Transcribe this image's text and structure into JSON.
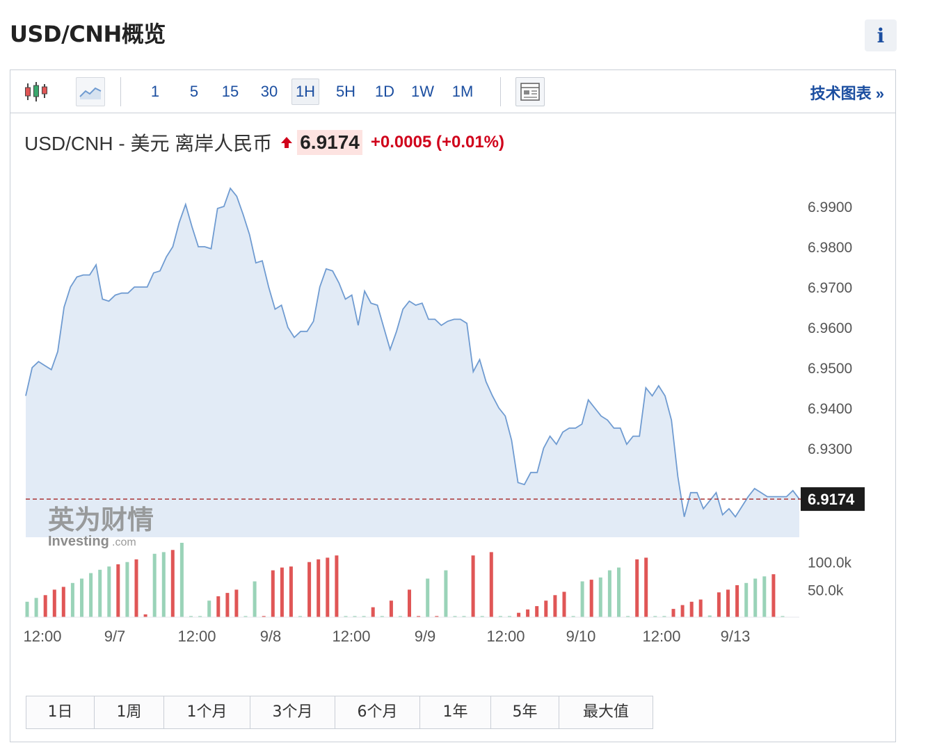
{
  "page": {
    "title": "USD/CNH概览",
    "info_label": "i"
  },
  "toolbar": {
    "timeframes": [
      "1",
      "5",
      "15",
      "30",
      "1H",
      "5H",
      "1D",
      "1W",
      "1M"
    ],
    "active_timeframe": "1H",
    "tech_chart_link": "技术图表 »",
    "icons": [
      "candlestick-icon",
      "line-chart-icon",
      "layout-icon"
    ]
  },
  "quote": {
    "name": "USD/CNH - 美元 离岸人民币",
    "price": "6.9174",
    "change": "+0.0005 (+0.01%)",
    "direction_icon": "up-arrow-icon"
  },
  "watermark": {
    "brand_cn": "英为财情",
    "brand_en": "Investing",
    "brand_suffix": ".com"
  },
  "range_buttons": [
    "1日",
    "1周",
    "1个月",
    "3个月",
    "6个月",
    "1年",
    "5年",
    "最大值"
  ],
  "colors": {
    "line": "#6f9bd1",
    "area": "#dde8f4",
    "up_volume": "#9ad3b8",
    "down_volume": "#e05656",
    "price_label_bg": "#1c1c1c",
    "link": "#1b4ea0",
    "change": "#d0021b"
  },
  "chart_data": {
    "type": "area",
    "price_axis": {
      "ticks": [
        6.99,
        6.98,
        6.97,
        6.96,
        6.95,
        6.94,
        6.93
      ],
      "tick_labels": [
        "6.9900",
        "6.9800",
        "6.9700",
        "6.9600",
        "6.9500",
        "6.9400",
        "6.9300"
      ]
    },
    "current_price": 6.9174,
    "current_price_label": "6.9174",
    "x_tick_labels": [
      "12:00",
      "9/7",
      "12:00",
      "9/8",
      "12:00",
      "9/9",
      "12:00",
      "9/10",
      "12:00",
      "9/13"
    ],
    "series": [
      {
        "values": [
          6.943,
          6.95,
          6.9515,
          6.9505,
          6.9495,
          6.954,
          6.965,
          6.97,
          6.9725,
          6.973,
          6.973,
          6.9755,
          6.967,
          6.9665,
          6.968,
          6.9685,
          6.9685,
          6.97,
          6.97,
          6.97,
          6.9735,
          6.974,
          6.9775,
          6.98,
          6.986,
          6.9905,
          6.985,
          6.98,
          6.98,
          6.9795,
          6.9895,
          6.99,
          6.9945,
          6.9925,
          6.988,
          6.983,
          6.976,
          6.9765,
          6.97,
          6.9645,
          6.9655,
          6.96,
          6.9575,
          6.959,
          6.959,
          6.9615,
          6.97,
          6.9745,
          6.974,
          6.971,
          6.967,
          6.968,
          6.9605,
          6.969,
          6.966,
          6.9655,
          6.96,
          6.9545,
          6.959,
          6.9645,
          6.9665,
          6.9655,
          6.966,
          6.962,
          6.962,
          6.9605,
          6.9615,
          6.962,
          6.962,
          6.961,
          6.949,
          6.952,
          6.9465,
          6.943,
          6.94,
          6.938,
          6.932,
          6.9215,
          6.921,
          6.924,
          6.924,
          6.93,
          6.933,
          6.931,
          6.934,
          6.935,
          6.935,
          6.936,
          6.942,
          6.94,
          6.938,
          6.937,
          6.935,
          6.935,
          6.931,
          6.933,
          6.933,
          6.945,
          6.943,
          6.9455,
          6.943,
          6.937,
          6.923,
          6.913,
          6.919,
          6.919,
          6.915,
          6.917,
          6.919,
          6.9135,
          6.915,
          6.913,
          6.9155,
          6.918,
          6.92,
          6.919,
          6.918,
          6.918,
          6.918,
          6.918,
          6.9195,
          6.9174
        ]
      }
    ],
    "volume_axis": {
      "ticks": [
        100000,
        50000
      ],
      "tick_labels": [
        "100.0k",
        "50.0k"
      ],
      "ymax": 140000
    },
    "volume": [
      {
        "v": 28000,
        "up": true
      },
      {
        "v": 35000,
        "up": true
      },
      {
        "v": 40000,
        "up": false
      },
      {
        "v": 50000,
        "up": false
      },
      {
        "v": 55000,
        "up": false
      },
      {
        "v": 62000,
        "up": true
      },
      {
        "v": 70000,
        "up": true
      },
      {
        "v": 80000,
        "up": true
      },
      {
        "v": 86000,
        "up": true
      },
      {
        "v": 92000,
        "up": true
      },
      {
        "v": 96000,
        "up": false
      },
      {
        "v": 100000,
        "up": true
      },
      {
        "v": 105000,
        "up": false
      },
      {
        "v": 5000,
        "up": false
      },
      {
        "v": 115000,
        "up": true
      },
      {
        "v": 118000,
        "up": true
      },
      {
        "v": 122000,
        "up": false
      },
      {
        "v": 135000,
        "up": true
      },
      {
        "v": 2000,
        "up": true
      },
      {
        "v": 2000,
        "up": true
      },
      {
        "v": 30000,
        "up": true
      },
      {
        "v": 38000,
        "up": false
      },
      {
        "v": 44000,
        "up": false
      },
      {
        "v": 50000,
        "up": false
      },
      {
        "v": 2000,
        "up": true
      },
      {
        "v": 65000,
        "up": true
      },
      {
        "v": 2000,
        "up": false
      },
      {
        "v": 85000,
        "up": false
      },
      {
        "v": 90000,
        "up": false
      },
      {
        "v": 92000,
        "up": false
      },
      {
        "v": 2000,
        "up": true
      },
      {
        "v": 100000,
        "up": false
      },
      {
        "v": 105000,
        "up": false
      },
      {
        "v": 108000,
        "up": false
      },
      {
        "v": 112000,
        "up": false
      },
      {
        "v": 2000,
        "up": true
      },
      {
        "v": 2000,
        "up": true
      },
      {
        "v": 2000,
        "up": true
      },
      {
        "v": 18000,
        "up": false
      },
      {
        "v": 2000,
        "up": true
      },
      {
        "v": 30000,
        "up": false
      },
      {
        "v": 2000,
        "up": true
      },
      {
        "v": 50000,
        "up": false
      },
      {
        "v": 2000,
        "up": false
      },
      {
        "v": 70000,
        "up": true
      },
      {
        "v": 2000,
        "up": false
      },
      {
        "v": 85000,
        "up": true
      },
      {
        "v": 2000,
        "up": true
      },
      {
        "v": 2000,
        "up": true
      },
      {
        "v": 112000,
        "up": false
      },
      {
        "v": 2000,
        "up": true
      },
      {
        "v": 118000,
        "up": false
      },
      {
        "v": 2000,
        "up": true
      },
      {
        "v": 2000,
        "up": true
      },
      {
        "v": 8000,
        "up": false
      },
      {
        "v": 14000,
        "up": false
      },
      {
        "v": 20000,
        "up": false
      },
      {
        "v": 30000,
        "up": false
      },
      {
        "v": 40000,
        "up": false
      },
      {
        "v": 46000,
        "up": false
      },
      {
        "v": 2000,
        "up": true
      },
      {
        "v": 65000,
        "up": true
      },
      {
        "v": 68000,
        "up": false
      },
      {
        "v": 72000,
        "up": true
      },
      {
        "v": 85000,
        "up": true
      },
      {
        "v": 90000,
        "up": true
      },
      {
        "v": 2000,
        "up": true
      },
      {
        "v": 105000,
        "up": false
      },
      {
        "v": 108000,
        "up": false
      },
      {
        "v": 2000,
        "up": true
      },
      {
        "v": 2000,
        "up": true
      },
      {
        "v": 15000,
        "up": false
      },
      {
        "v": 22000,
        "up": false
      },
      {
        "v": 28000,
        "up": false
      },
      {
        "v": 32000,
        "up": false
      },
      {
        "v": 3000,
        "up": true
      },
      {
        "v": 45000,
        "up": false
      },
      {
        "v": 50000,
        "up": false
      },
      {
        "v": 58000,
        "up": false
      },
      {
        "v": 62000,
        "up": true
      },
      {
        "v": 70000,
        "up": true
      },
      {
        "v": 74000,
        "up": true
      },
      {
        "v": 78000,
        "up": false
      },
      {
        "v": 2000,
        "up": true
      }
    ]
  }
}
